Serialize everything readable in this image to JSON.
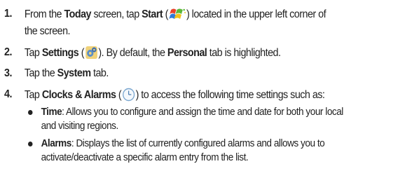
{
  "steps": [
    {
      "num": "1.",
      "parts": {
        "a": "From the ",
        "b_today": "Today",
        "c": " screen, tap ",
        "d_start": "Start",
        "e": " (",
        "f": ") located in the upper left corner of",
        "g": "the screen."
      },
      "icon": "windows-start-flag-icon"
    },
    {
      "num": "2.",
      "parts": {
        "a": "Tap ",
        "b_settings": "Settings",
        "c": " (",
        "d": "). By default, the ",
        "e_personal": "Personal",
        "f": " tab is highlighted."
      },
      "icon": "settings-gears-icon"
    },
    {
      "num": "3.",
      "parts": {
        "a": "Tap the ",
        "b_system": "System",
        "c": " tab."
      }
    },
    {
      "num": "4.",
      "parts": {
        "a": "Tap ",
        "b_clocks": "Clocks & Alarms",
        "c": " (",
        "d": ") to access the following time settings such as:"
      },
      "icon": "clock-icon"
    }
  ],
  "bullets": [
    {
      "term": "Time",
      "line1": ": Allows you to configure and assign the time and date for both your local",
      "line2": "and visiting regions."
    },
    {
      "term": "Alarms",
      "line1": ": Displays the list of currently configured alarms and allows you to",
      "line2": "activate/deactivate a specific alarm entry from the list."
    }
  ]
}
